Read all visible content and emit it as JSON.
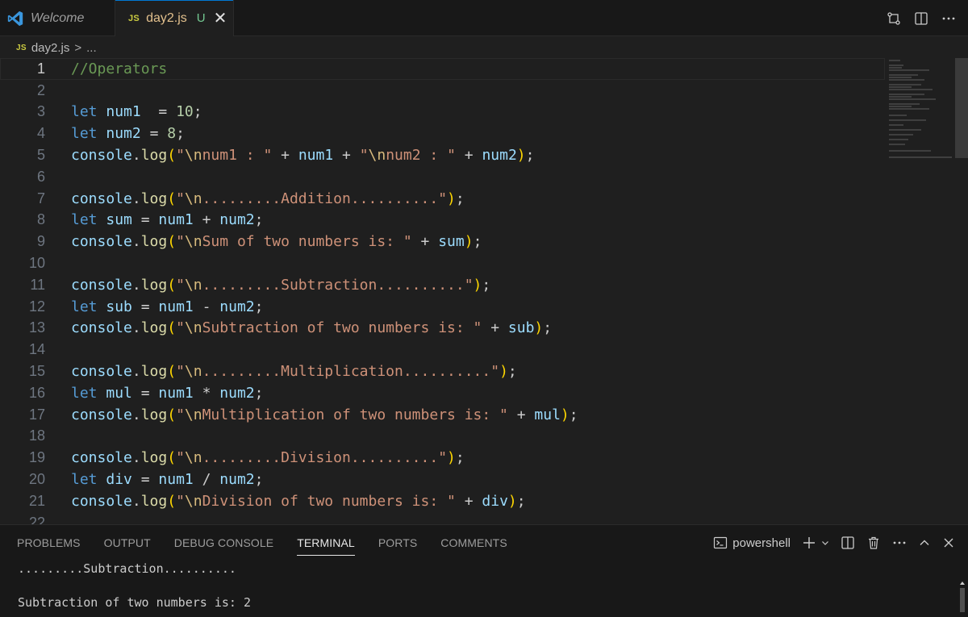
{
  "tabs": [
    {
      "label": "Welcome",
      "icon": "vscode-icon"
    },
    {
      "label": "day2.js",
      "badge": "JS",
      "status": "U"
    }
  ],
  "editor_actions": [
    "source-control-icon",
    "split-editor-icon",
    "more-actions-icon"
  ],
  "breadcrumb": {
    "badge": "JS",
    "file": "day2.js",
    "separator": ">",
    "rest": "..."
  },
  "line_numbers": [
    "1",
    "2",
    "3",
    "4",
    "5",
    "6",
    "7",
    "8",
    "9",
    "10",
    "11",
    "12",
    "13",
    "14",
    "15",
    "16",
    "17",
    "18",
    "19",
    "20",
    "21",
    "22"
  ],
  "code": [
    "//Operators",
    "",
    "let num1  = 10;",
    "let num2 = 8;",
    "console.log(\"\\nnum1 : \" + num1 + \"\\nnum2 : \" + num2);",
    "",
    "console.log(\"\\n.........Addition..........\");",
    "let sum = num1 + num2;",
    "console.log(\"\\nSum of two numbers is: \" + sum);",
    "",
    "console.log(\"\\n.........Subtraction..........\");",
    "let sub = num1 - num2;",
    "console.log(\"\\nSubtraction of two numbers is: \" + sub);",
    "",
    "console.log(\"\\n.........Multiplication..........\");",
    "let mul = num1 * num2;",
    "console.log(\"\\nMultiplication of two numbers is: \" + mul);",
    "",
    "console.log(\"\\n.........Division..........\");",
    "let div = num1 / num2;",
    "console.log(\"\\nDivision of two numbers is: \" + div);",
    ""
  ],
  "panel": {
    "tabs": [
      "PROBLEMS",
      "OUTPUT",
      "DEBUG CONSOLE",
      "TERMINAL",
      "PORTS",
      "COMMENTS"
    ],
    "active_tab": "TERMINAL",
    "shell": "powershell"
  },
  "terminal_lines": [
    ".........Subtraction..........",
    "",
    "Subtraction of two numbers is: 2"
  ],
  "colors": {
    "keyword": "#569cd6",
    "variable": "#9cdcfe",
    "number": "#b5cea8",
    "string": "#ce9178",
    "function": "#dcdcaa",
    "comment": "#6a9955"
  }
}
